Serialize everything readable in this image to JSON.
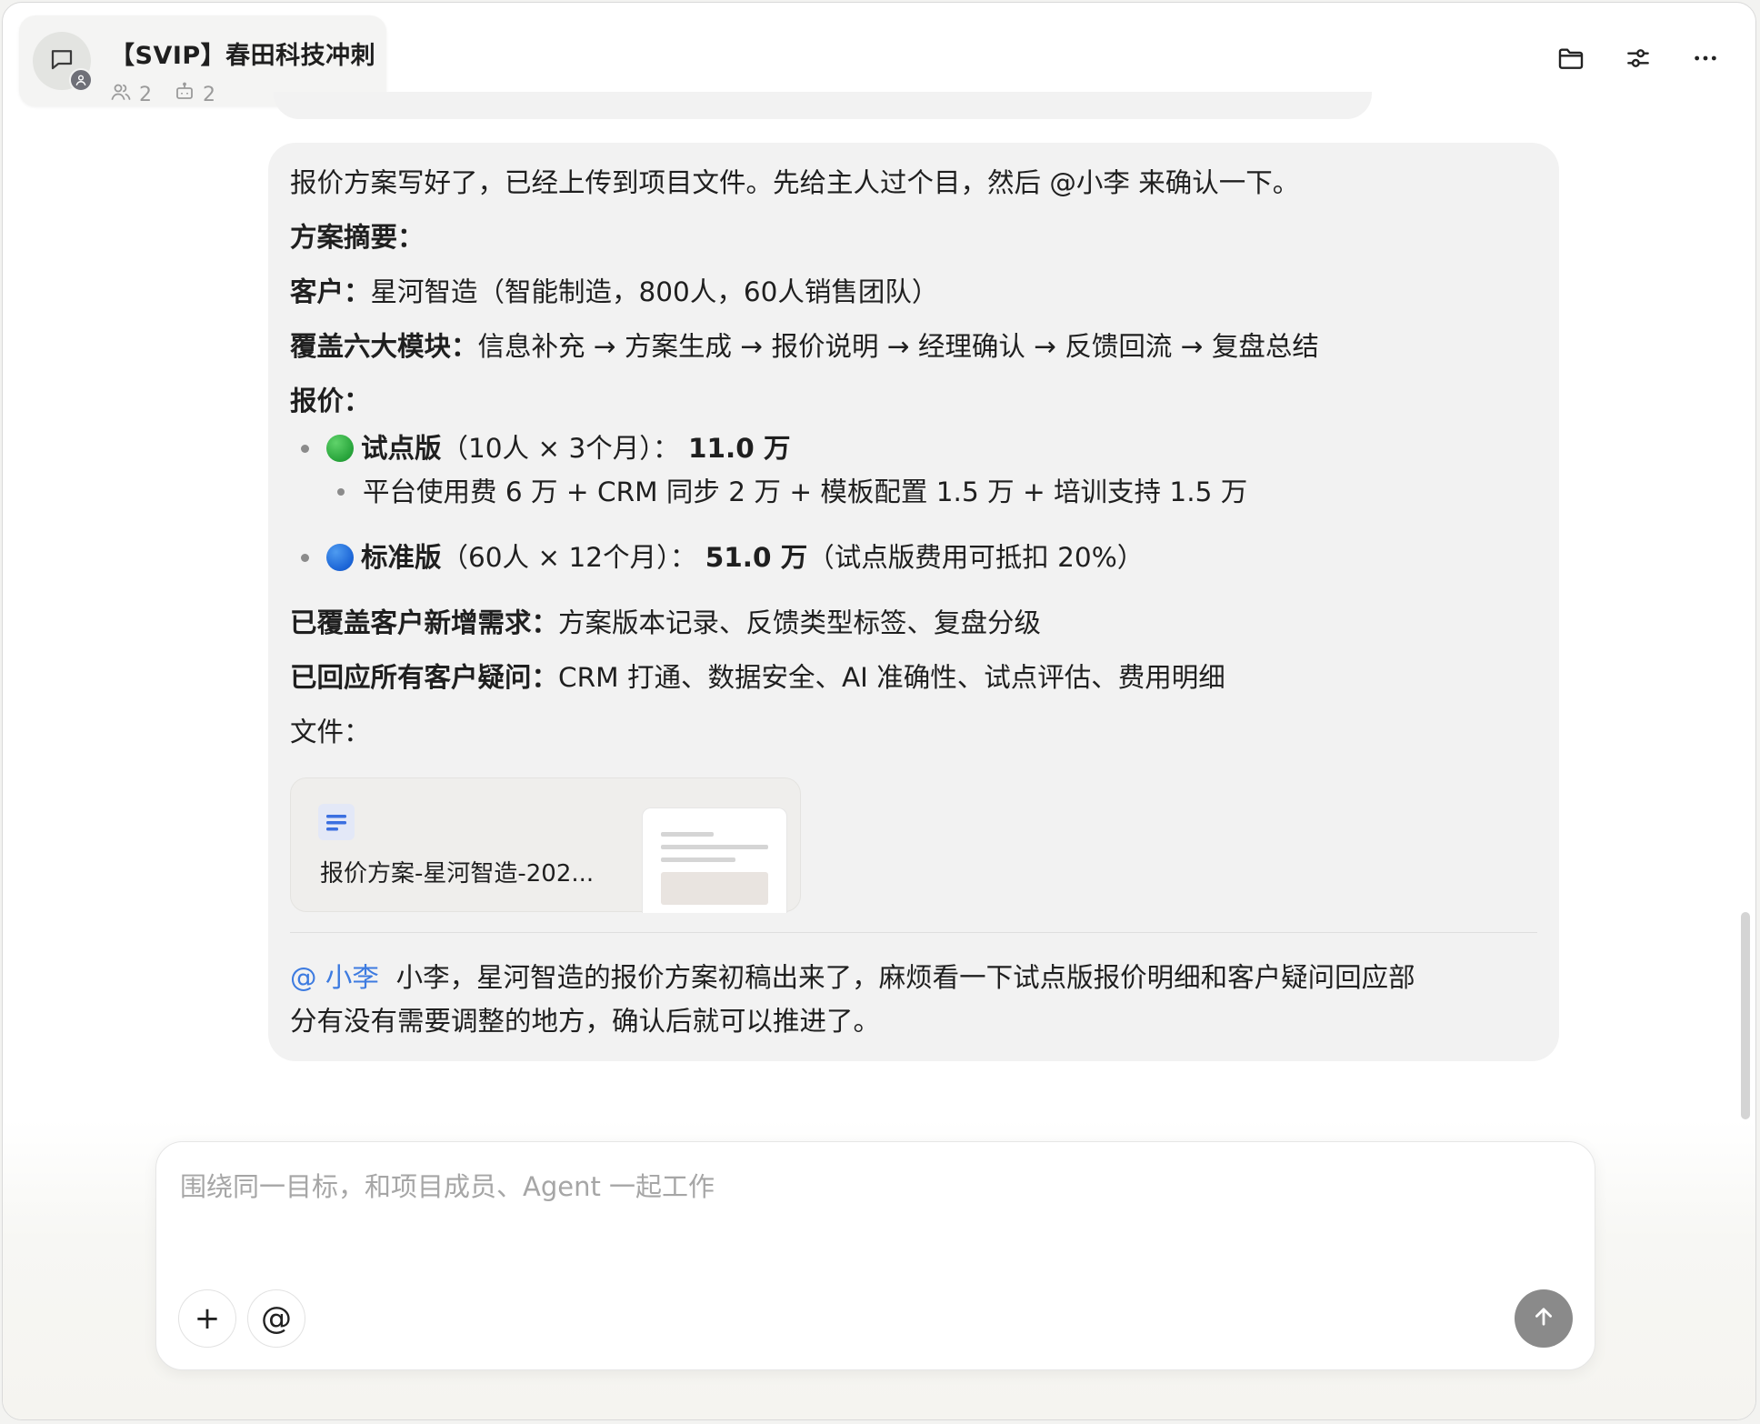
{
  "header": {
    "title": "【SVIP】春田科技冲刺",
    "member_count": "2",
    "agent_count": "2",
    "avatar_icon": "chat-bubble-icon",
    "actions": [
      "folder-icon",
      "settings-sliders-icon",
      "more-icon"
    ]
  },
  "message": {
    "intro": "报价方案写好了，已经上传到项目文件。先给主人过个目，然后 @小李 来确认一下。",
    "summary_label": "方案摘要：",
    "client_label": "客户：",
    "client_value": "星河智造（智能制造，800人，60人销售团队）",
    "modules_label": "覆盖六大模块：",
    "modules_value": "信息补充 → 方案生成 → 报价说明 → 经理确认 → 反馈回流 → 复盘总结",
    "pricing_label": "报价：",
    "pilot": {
      "name": "试点版",
      "detail": "（10人 × 3个月）：",
      "price": "11.0 万",
      "breakdown": "平台使用费 6 万 + CRM 同步 2 万 + 模板配置 1.5 万 + 培训支持 1.5 万",
      "color": "#27a33a"
    },
    "standard": {
      "name": "标准版",
      "detail": "（60人 × 12个月）：",
      "price": "51.0 万",
      "note": "（试点版费用可抵扣 20%）",
      "color": "#1b64d6"
    },
    "new_needs_label": "已覆盖客户新增需求：",
    "new_needs_value": "方案版本记录、反馈类型标签、复盘分级",
    "questions_label": "已回应所有客户疑问：",
    "questions_value": "CRM 打通、数据安全、AI 准确性、试点评估、费用明细",
    "files_label": "文件：",
    "file_name": "报价方案-星河智造-202...",
    "mention": "@ 小李",
    "mention_text_1": "小李，星河智造的报价方案初稿出来了，麻烦看一下试点版报价明细和客户疑问回应部",
    "mention_text_2": "分有没有需要调整的地方，确认后就可以推进了。",
    "mention_color": "#3d7be0"
  },
  "composer": {
    "placeholder": "围绕同一目标，和项目成员、Agent 一起工作",
    "add_label": "+",
    "at_label": "@",
    "send_icon": "arrow-up-icon"
  }
}
